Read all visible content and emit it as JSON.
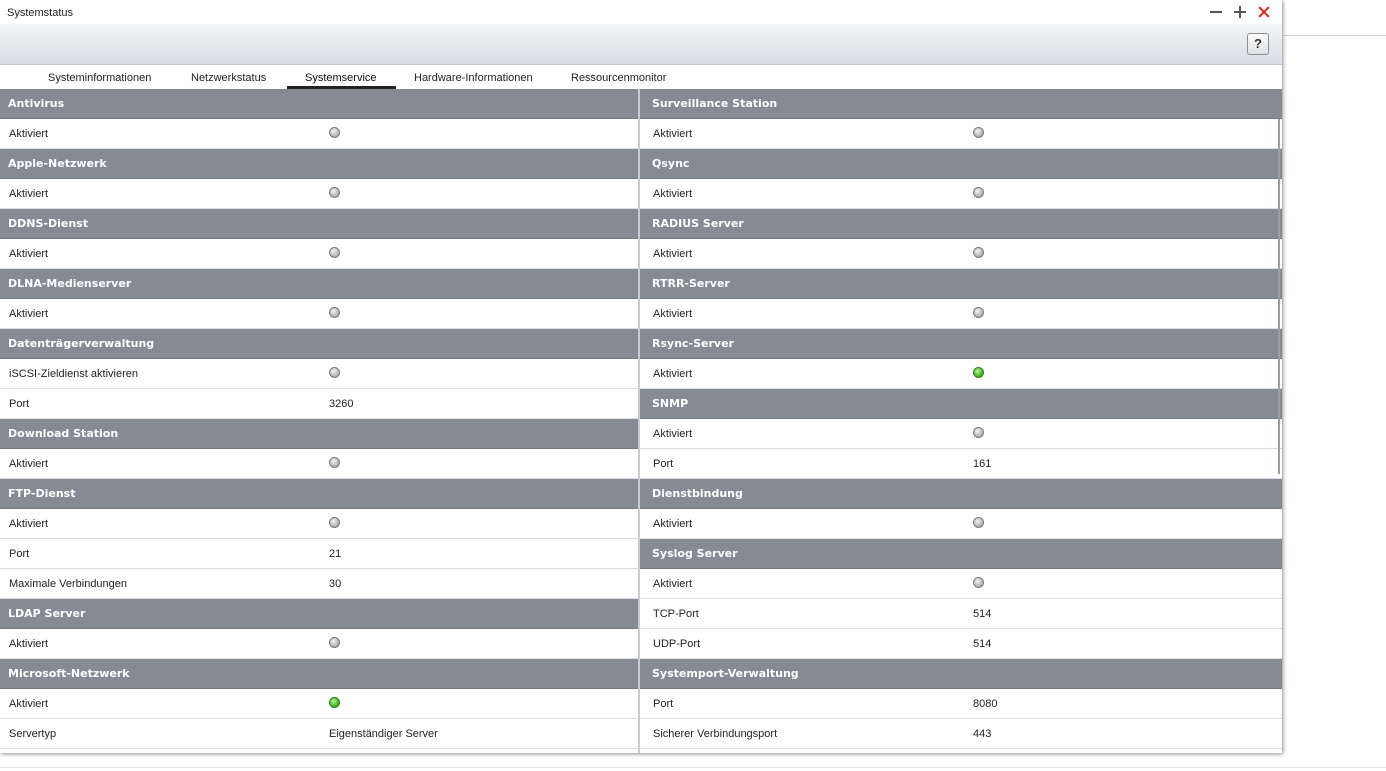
{
  "window": {
    "title": "Systemstatus"
  },
  "toolbar": {
    "help_label": "?"
  },
  "tabs": [
    {
      "label": "Systeminformationen"
    },
    {
      "label": "Netzwerkstatus"
    },
    {
      "label": "Systemservice"
    },
    {
      "label": "Hardware-Informationen"
    },
    {
      "label": "Ressourcenmonitor"
    }
  ],
  "active_tab": "Systemservice",
  "status_colors": {
    "enabled": "#4cbf2a",
    "disabled": "#bdbdbd",
    "header": "#868a95"
  },
  "left_groups": [
    {
      "title": "Antivirus",
      "rows": [
        {
          "label": "Aktiviert",
          "status": "off"
        }
      ]
    },
    {
      "title": "Apple-Netzwerk",
      "rows": [
        {
          "label": "Aktiviert",
          "status": "off"
        }
      ]
    },
    {
      "title": "DDNS-Dienst",
      "rows": [
        {
          "label": "Aktiviert",
          "status": "off"
        }
      ]
    },
    {
      "title": "DLNA-Medienserver",
      "rows": [
        {
          "label": "Aktiviert",
          "status": "off"
        }
      ]
    },
    {
      "title": "Datenträgerverwaltung",
      "rows": [
        {
          "label": "iSCSI-Zieldienst aktivieren",
          "status": "off"
        },
        {
          "label": "Port",
          "value": "3260"
        }
      ]
    },
    {
      "title": "Download Station",
      "rows": [
        {
          "label": "Aktiviert",
          "status": "off"
        }
      ]
    },
    {
      "title": "FTP-Dienst",
      "rows": [
        {
          "label": "Aktiviert",
          "status": "off"
        },
        {
          "label": "Port",
          "value": "21"
        },
        {
          "label": "Maximale Verbindungen",
          "value": "30"
        }
      ]
    },
    {
      "title": "LDAP Server",
      "rows": [
        {
          "label": "Aktiviert",
          "status": "off"
        }
      ]
    },
    {
      "title": "Microsoft-Netzwerk",
      "rows": [
        {
          "label": "Aktiviert",
          "status": "on"
        },
        {
          "label": "Servertyp",
          "value": "Eigenständiger Server"
        }
      ]
    }
  ],
  "right_groups": [
    {
      "title": "Surveillance Station",
      "rows": [
        {
          "label": "Aktiviert",
          "status": "off"
        }
      ]
    },
    {
      "title": "Qsync",
      "rows": [
        {
          "label": "Aktiviert",
          "status": "off"
        }
      ]
    },
    {
      "title": "RADIUS Server",
      "rows": [
        {
          "label": "Aktiviert",
          "status": "off"
        }
      ]
    },
    {
      "title": "RTRR-Server",
      "rows": [
        {
          "label": "Aktiviert",
          "status": "off"
        }
      ]
    },
    {
      "title": "Rsync-Server",
      "rows": [
        {
          "label": "Aktiviert",
          "status": "on"
        }
      ]
    },
    {
      "title": "SNMP",
      "rows": [
        {
          "label": "Aktiviert",
          "status": "off"
        },
        {
          "label": "Port",
          "value": "161"
        }
      ]
    },
    {
      "title": "Dienstbindung",
      "rows": [
        {
          "label": "Aktiviert",
          "status": "off"
        }
      ]
    },
    {
      "title": "Syslog Server",
      "rows": [
        {
          "label": "Aktiviert",
          "status": "off"
        },
        {
          "label": "TCP-Port",
          "value": "514"
        },
        {
          "label": "UDP-Port",
          "value": "514"
        }
      ]
    },
    {
      "title": "Systemport-Verwaltung",
      "rows": [
        {
          "label": "Port",
          "value": "8080"
        },
        {
          "label": "Sicherer Verbindungsport",
          "value": "443"
        }
      ]
    }
  ]
}
